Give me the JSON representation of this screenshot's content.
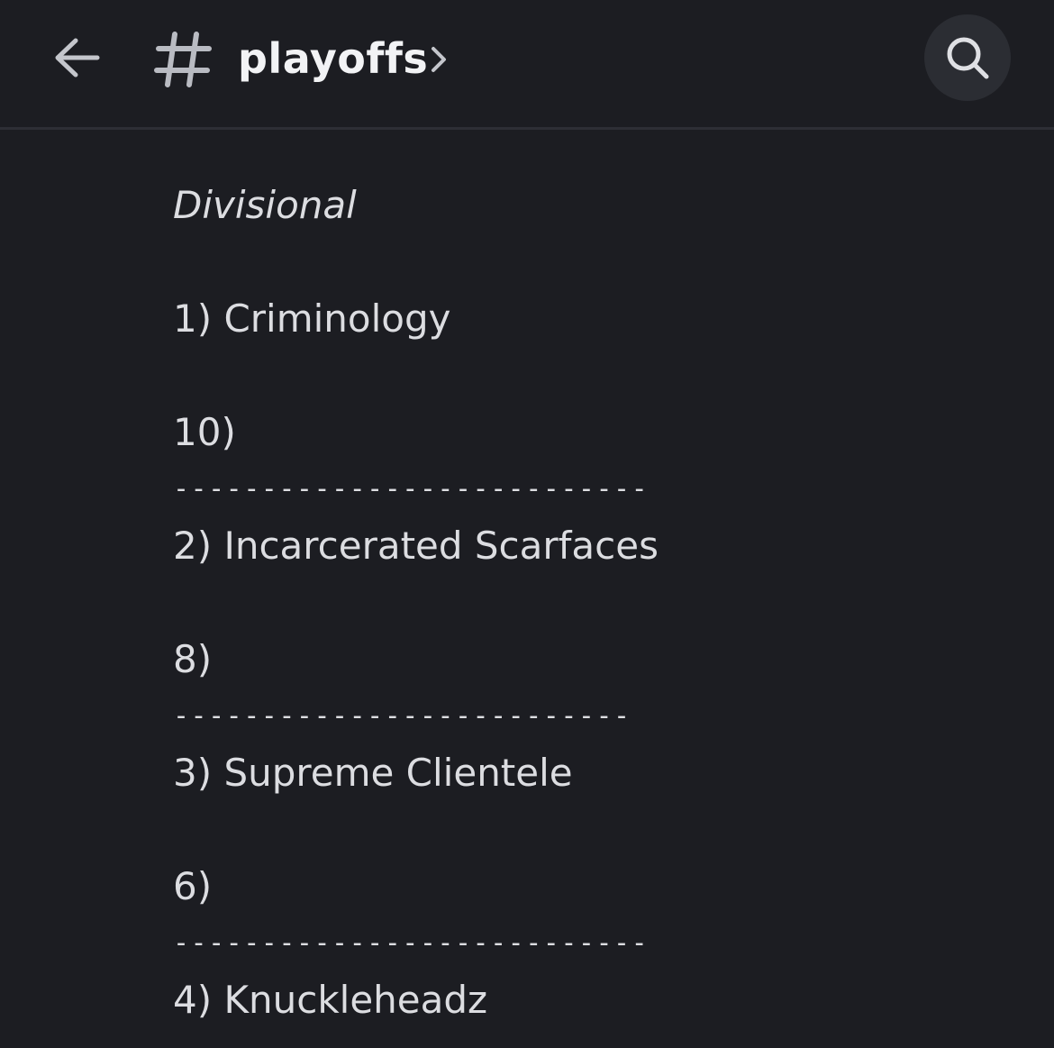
{
  "header": {
    "channel_name": "playoffs"
  },
  "icons": {
    "back": "arrow-left-icon",
    "channel": "hash-icon",
    "chevron": "chevron-right-icon",
    "search": "search-icon"
  },
  "colors": {
    "background": "#1c1d22",
    "header_border": "#2d2e35",
    "search_bg": "#2b2d33",
    "text": "#dcdde1"
  },
  "message": {
    "lines": [
      {
        "text": "Divisional",
        "style": "italic"
      },
      {
        "text": "",
        "style": "normal"
      },
      {
        "text": "1) Criminology",
        "style": "normal"
      },
      {
        "text": "",
        "style": "normal"
      },
      {
        "text": "10)",
        "style": "normal"
      },
      {
        "text": "---------------------------",
        "style": "sep"
      },
      {
        "text": "2) Incarcerated Scarfaces",
        "style": "normal"
      },
      {
        "text": "",
        "style": "normal"
      },
      {
        "text": "8)",
        "style": "normal"
      },
      {
        "text": "--------------------------",
        "style": "sep"
      },
      {
        "text": "3) Supreme Clientele",
        "style": "normal"
      },
      {
        "text": "",
        "style": "normal"
      },
      {
        "text": "6)",
        "style": "normal"
      },
      {
        "text": "---------------------------",
        "style": "sep"
      },
      {
        "text": "4) Knuckleheadz",
        "style": "normal"
      }
    ]
  }
}
